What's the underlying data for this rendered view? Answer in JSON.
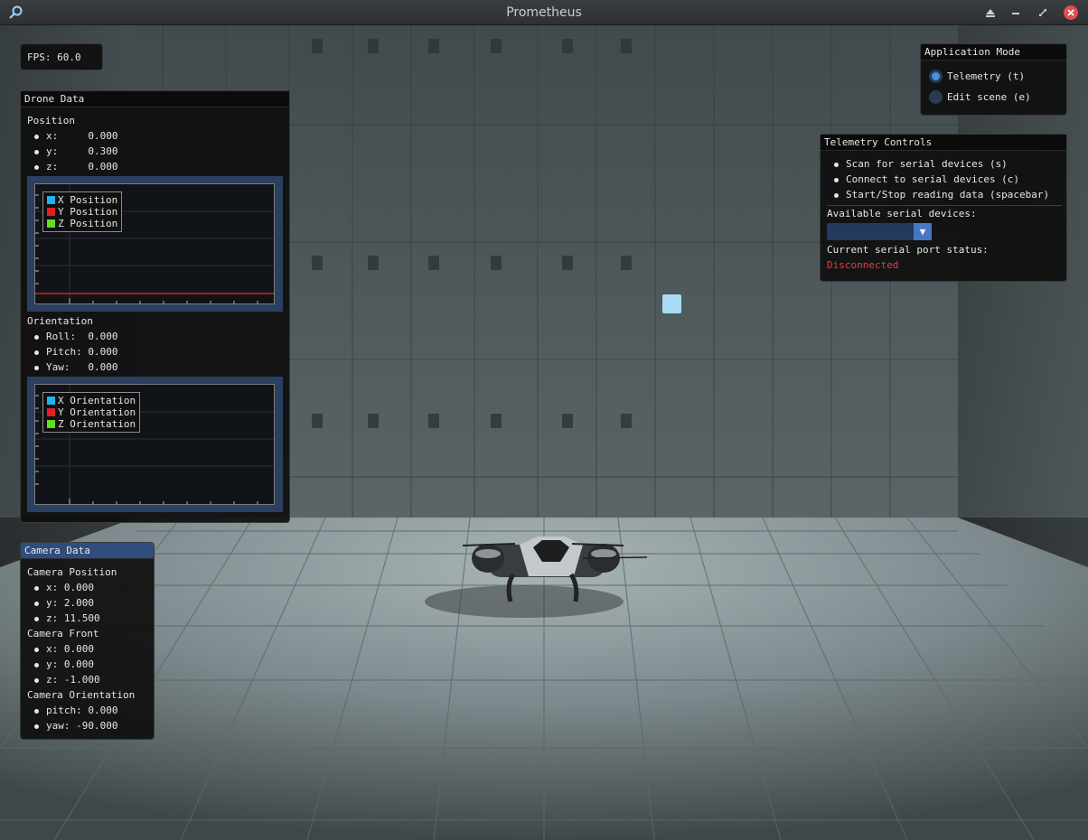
{
  "window": {
    "title": "Prometheus"
  },
  "fps": {
    "label": "FPS: 60.0"
  },
  "drone": {
    "header": "Drone Data",
    "position": {
      "title": "Position",
      "x": "x:     0.000",
      "y": "y:     0.300",
      "z": "z:     0.000"
    },
    "position_plot": {
      "legend": [
        "X Position",
        "Y Position",
        "Z Position"
      ]
    },
    "orientation": {
      "title": "Orientation",
      "roll": "Roll:  0.000",
      "pitch": "Pitch: 0.000",
      "yaw": "Yaw:   0.000"
    },
    "orientation_plot": {
      "legend": [
        "X Orientation",
        "Y Orientation",
        "Z Orientation"
      ]
    }
  },
  "camera": {
    "header": "Camera Data",
    "position": {
      "title": "Camera Position",
      "x": "x: 0.000",
      "y": "y: 2.000",
      "z": "z: 11.500"
    },
    "front": {
      "title": "Camera Front",
      "x": "x: 0.000",
      "y": "y: 0.000",
      "z": "z: -1.000"
    },
    "orientation": {
      "title": "Camera Orientation",
      "pitch": "pitch: 0.000",
      "yaw": "yaw: -90.000"
    }
  },
  "mode": {
    "header": "Application Mode",
    "options": [
      "Telemetry (t)",
      "Edit scene (e)"
    ],
    "selected": "Telemetry (t)"
  },
  "telemetry": {
    "header": "Telemetry Controls",
    "items": [
      "Scan for serial devices (s)",
      "Connect to serial devices (c)",
      "Start/Stop reading data (spacebar)"
    ],
    "devices_label": "Available serial devices:",
    "devices_value": "",
    "status_label": "Current serial port status:",
    "status_value": "Disconnected"
  },
  "colors": {
    "x_series": "#1fb2ee",
    "y_series": "#e02020",
    "z_series": "#5ee01f",
    "status_disconnected": "#ff3333",
    "accent": "#2f4d7c"
  }
}
